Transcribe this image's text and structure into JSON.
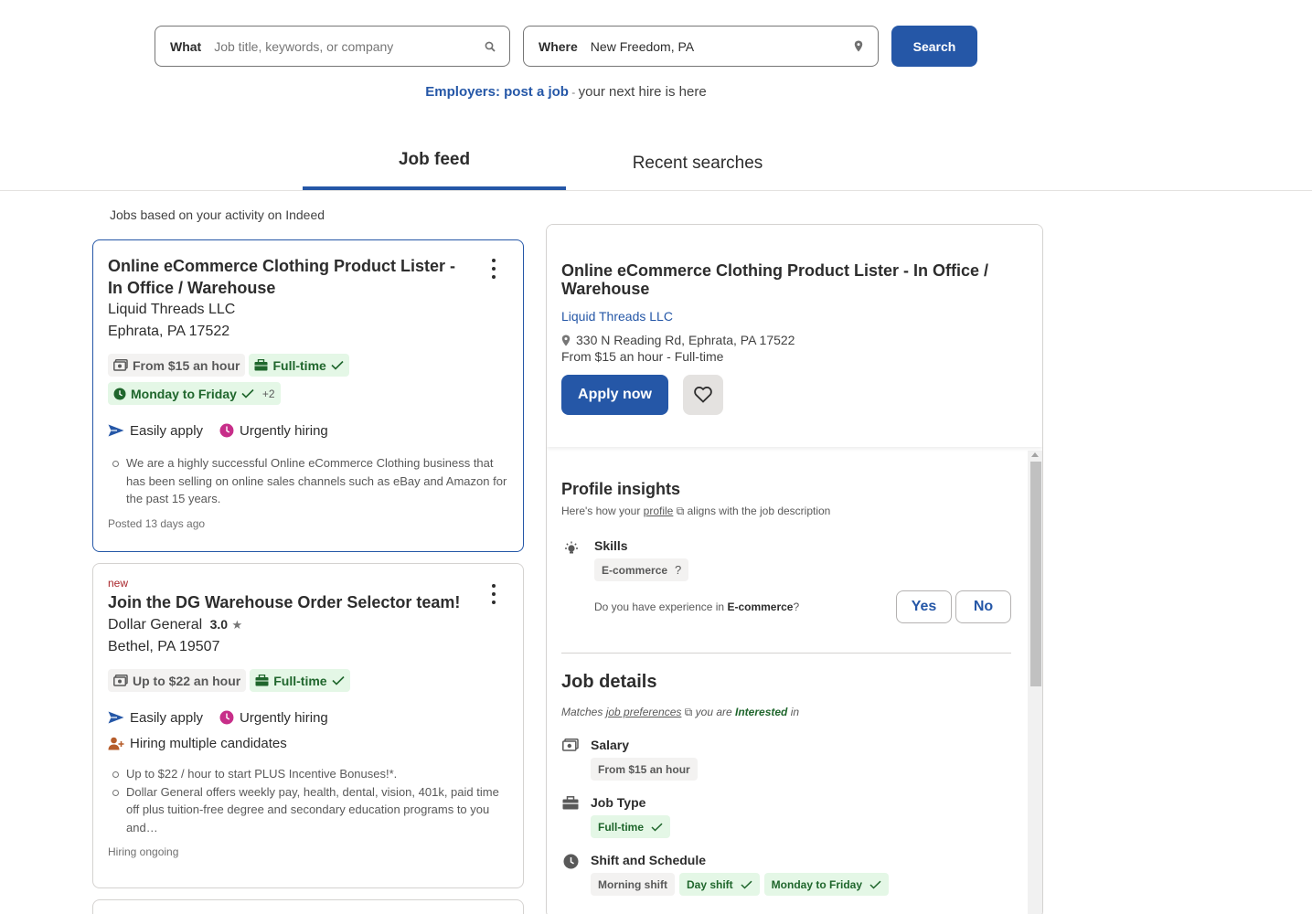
{
  "search": {
    "what_label": "What",
    "what_placeholder": "Job title, keywords, or company",
    "where_label": "Where",
    "where_value": "New Freedom, PA",
    "button": "Search"
  },
  "employers": {
    "link": "Employers: post a job",
    "sep": " - ",
    "rest": "your next hire is here"
  },
  "tabs": [
    {
      "label": "Job feed",
      "active": true
    },
    {
      "label": "Recent searches",
      "active": false
    }
  ],
  "feed_caption": "Jobs based on your activity on Indeed",
  "jobs": [
    {
      "title": "Online eCommerce Clothing Product Lister - In Office / Warehouse",
      "company": "Liquid Threads LLC",
      "location": "Ephrata, PA 17522",
      "pay": "From $15 an hour",
      "type": "Full-time",
      "schedule": "Monday to Friday",
      "more": "+2",
      "easily_apply": "Easily apply",
      "urgently_hiring": "Urgently hiring",
      "snippet": [
        "We are a highly successful Online eCommerce Clothing business that has been selling on online sales channels such as eBay and Amazon for the past 15 years."
      ],
      "posted": "Posted 13 days ago"
    },
    {
      "new": "new",
      "title": "Join the DG Warehouse Order Selector team!",
      "company": "Dollar General",
      "rating": "3.0",
      "location": "Bethel, PA 19507",
      "pay": "Up to $22 an hour",
      "type": "Full-time",
      "easily_apply": "Easily apply",
      "urgently_hiring": "Urgently hiring",
      "multiple": "Hiring multiple candidates",
      "snippet": [
        "Up to $22 / hour to start PLUS Incentive Bonuses!*.",
        "Dollar General offers weekly pay, health, dental, vision, 401k, paid time off plus tuition-free degree and secondary education programs to you and…"
      ],
      "posted": "Hiring ongoing"
    }
  ],
  "detail": {
    "title": "Online eCommerce Clothing Product Lister - In Office / Warehouse",
    "company": "Liquid Threads LLC",
    "address": "330 N Reading Rd, Ephrata, PA 17522",
    "pay_type": "From $15 an hour  - Full-time",
    "apply": "Apply now",
    "insights_title": "Profile insights",
    "insights_sub_1": "Here's how your ",
    "insights_sub_link": "profile",
    "insights_sub_2": " aligns with the job description",
    "skills_label": "Skills",
    "skill_tag": "E-commerce",
    "skill_q": "?",
    "question_1": "Do you have experience in ",
    "question_bold": "E-commerce",
    "question_2": "?",
    "yes": "Yes",
    "no": "No",
    "jd_title": "Job details",
    "jd_sub_1": "Matches ",
    "jd_sub_link": "job preferences",
    "jd_sub_2": " you are ",
    "jd_sub_interested": "Interested",
    "jd_sub_3": " in",
    "salary_label": "Salary",
    "salary_tag": "From $15 an hour",
    "jobtype_label": "Job Type",
    "jobtype_tag": "Full-time",
    "shift_label": "Shift and Schedule",
    "shift_tags": [
      "Morning shift",
      "Day shift",
      "Monday to Friday"
    ]
  },
  "colors": {
    "accent": "#2557a7",
    "green": "#1f662c",
    "urgent": "#c72e89"
  }
}
